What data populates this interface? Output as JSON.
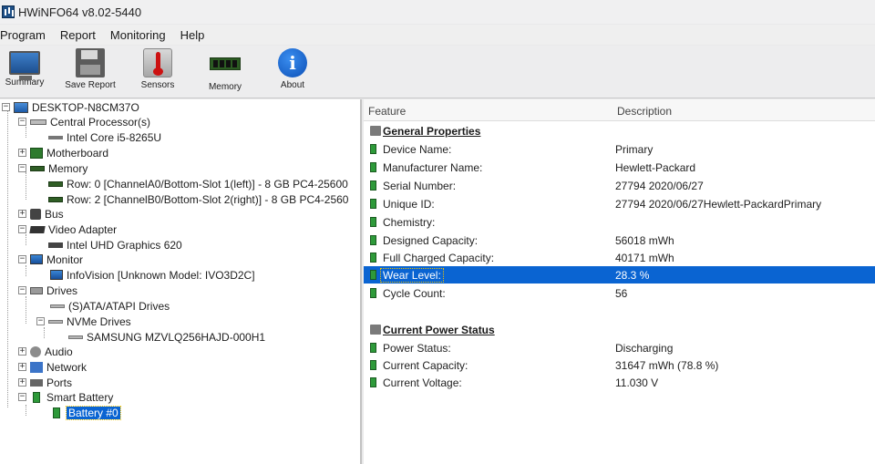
{
  "window": {
    "title": "HWiNFO64 v8.02-5440"
  },
  "menu": [
    "Program",
    "Report",
    "Monitoring",
    "Help"
  ],
  "toolbar": [
    {
      "label": "Summary",
      "icon": "monitor-icon"
    },
    {
      "label": "Save Report",
      "icon": "floppy-disk-icon"
    },
    {
      "label": "Sensors",
      "icon": "thermometer-icon"
    },
    {
      "label": "Memory",
      "icon": "memory-module-icon"
    },
    {
      "label": "About",
      "icon": "info-icon"
    }
  ],
  "tree": {
    "root": "DESKTOP-N8CM37O",
    "nodes": [
      {
        "label": "Central Processor(s)",
        "icon": "cpu-icon"
      },
      {
        "label": "Intel Core i5-8265U",
        "icon": "chip-icon"
      },
      {
        "label": "Motherboard",
        "icon": "motherboard-icon"
      },
      {
        "label": "Memory",
        "icon": "memory-icon"
      },
      {
        "label": "Row: 0 [ChannelA0/Bottom-Slot 1(left)] - 8 GB PC4-25600",
        "icon": "memory-module-icon"
      },
      {
        "label": "Row: 2 [ChannelB0/Bottom-Slot 2(right)] - 8 GB PC4-2560",
        "icon": "memory-module-icon"
      },
      {
        "label": "Bus",
        "icon": "bus-icon"
      },
      {
        "label": "Video Adapter",
        "icon": "video-card-icon"
      },
      {
        "label": "Intel UHD Graphics 620",
        "icon": "gpu-icon"
      },
      {
        "label": "Monitor",
        "icon": "monitor-icon"
      },
      {
        "label": "InfoVision [Unknown Model: IVO3D2C]",
        "icon": "monitor-icon"
      },
      {
        "label": "Drives",
        "icon": "drives-icon"
      },
      {
        "label": "(S)ATA/ATAPI Drives",
        "icon": "disk-icon"
      },
      {
        "label": "NVMe Drives",
        "icon": "disk-icon"
      },
      {
        "label": "SAMSUNG MZVLQ256HAJD-000H1",
        "icon": "disk-icon"
      },
      {
        "label": "Audio",
        "icon": "audio-icon"
      },
      {
        "label": "Network",
        "icon": "network-icon"
      },
      {
        "label": "Ports",
        "icon": "ports-icon"
      },
      {
        "label": "Smart Battery",
        "icon": "battery-icon"
      },
      {
        "label": "Battery #0",
        "icon": "battery-icon",
        "selected": true
      }
    ]
  },
  "table": {
    "headers": {
      "feature": "Feature",
      "description": "Description"
    },
    "sections": [
      {
        "title": "General Properties",
        "rows": [
          {
            "feature": "Device Name:",
            "value": "Primary"
          },
          {
            "feature": "Manufacturer Name:",
            "value": "Hewlett-Packard"
          },
          {
            "feature": "Serial Number:",
            "value": "27794 2020/06/27"
          },
          {
            "feature": "Unique ID:",
            "value": "27794 2020/06/27Hewlett-PackardPrimary"
          },
          {
            "feature": "Chemistry:",
            "value": ""
          },
          {
            "feature": "Designed Capacity:",
            "value": "56018 mWh"
          },
          {
            "feature": "Full Charged Capacity:",
            "value": "40171 mWh"
          },
          {
            "feature": "Wear Level:",
            "value": "28.3 %",
            "selected": true
          },
          {
            "feature": "Cycle Count:",
            "value": "56"
          }
        ]
      },
      {
        "title": "Current Power Status",
        "rows": [
          {
            "feature": "Power Status:",
            "value": "Discharging"
          },
          {
            "feature": "Current Capacity:",
            "value": "31647 mWh (78.8 %)"
          },
          {
            "feature": "Current Voltage:",
            "value": "11.030 V"
          }
        ]
      }
    ]
  },
  "colors": {
    "selection": "#0a64d2",
    "background": "#ffffff",
    "battery_icon": "#2e9a3a"
  }
}
